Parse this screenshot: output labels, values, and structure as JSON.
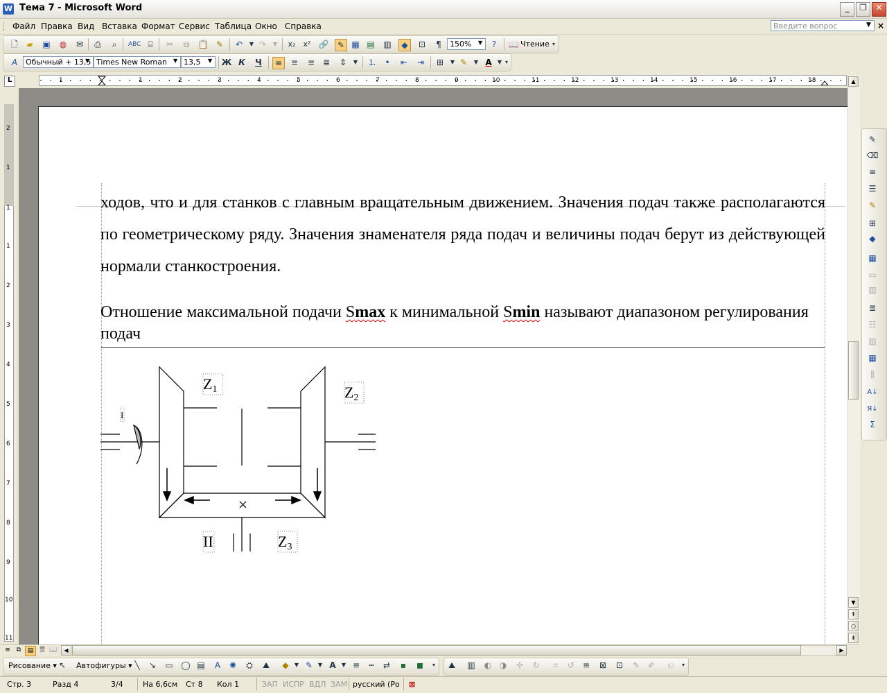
{
  "window": {
    "title": "Тема 7 - Microsoft Word",
    "app_icon": "W",
    "minimize": "_",
    "maximize": "❐",
    "close": "✕"
  },
  "menu": {
    "items": [
      "Файл",
      "Правка",
      "Вид",
      "Вставка",
      "Формат",
      "Сервис",
      "Таблица",
      "Окно",
      "Справка"
    ],
    "help_placeholder": "Введите вопрос",
    "doc_close": "×"
  },
  "standard_toolbar": {
    "zoom": "150%",
    "reading_label": "Чтение",
    "pilcrow": "¶"
  },
  "format_toolbar": {
    "style": "Обычный + 13,5",
    "font": "Times New Roman",
    "size": "13,5",
    "bold": "Ж",
    "italic": "К",
    "underline": "Ч"
  },
  "ruler": {
    "tab_selector": "L",
    "numbers": [
      "1",
      "1",
      "2",
      "3",
      "4",
      "5",
      "6",
      "7",
      "8",
      "9",
      "10",
      "11",
      "12",
      "13",
      "14",
      "15",
      "16",
      "17",
      "18"
    ],
    "vertical_numbers": [
      "2",
      "1",
      "1",
      "1",
      "2",
      "3",
      "4",
      "5",
      "6",
      "7",
      "8",
      "9",
      "10",
      "11"
    ]
  },
  "document": {
    "paragraph1": "ходов, что и для станков с главным вращательным движением. Значения подач также располагаются по геометрическому ряду. Значения знаменателя ряда подач и величины подач берут из действующей нормали станкостроения.",
    "p2_a": "Отношение максимальной подачи ",
    "p2_s1": "S",
    "p2_max": "max",
    "p2_b": " к минимальной ",
    "p2_s2": "S",
    "p2_min": "min",
    "p2_c": " называют диапазоном регулирования подач",
    "diagram": {
      "z1": "Z",
      "z1_sub": "1",
      "z2": "Z",
      "z2_sub": "2",
      "z3": "Z",
      "z3_sub": "3",
      "label_two": "II",
      "label_one": "I",
      "cross": "×"
    }
  },
  "drawing_toolbar": {
    "drawing_label": "Рисование ▾",
    "autoshapes_label": "Автофигуры ▾"
  },
  "statusbar": {
    "page": "Стр. 3",
    "section": "Разд 4",
    "pages": "3/4",
    "at": "На 6,6см",
    "line": "Ст 8",
    "col": "Кол 1",
    "rec": "ЗАП",
    "trk": "ИСПР",
    "ext": "ВДЛ",
    "ovr": "ЗАМ",
    "lang": "русский (Ро"
  }
}
